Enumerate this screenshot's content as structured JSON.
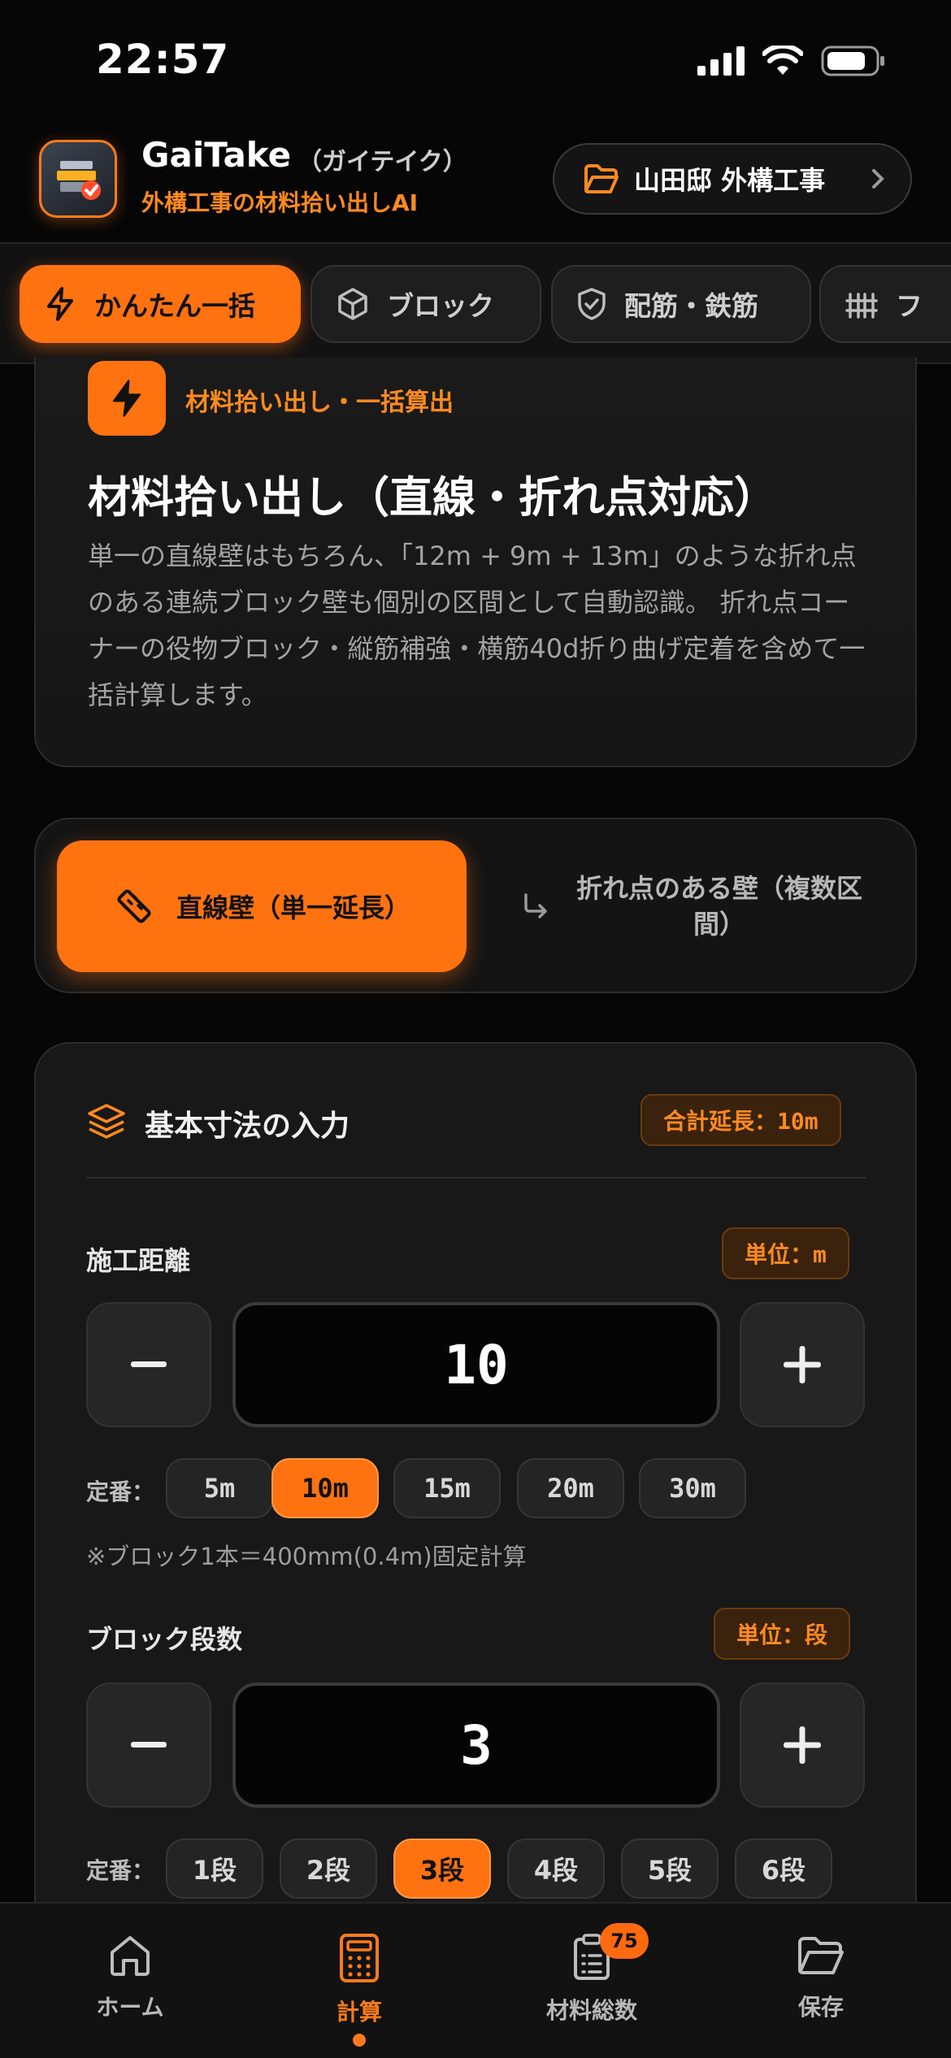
{
  "status_bar": {
    "time": "22:57"
  },
  "app": {
    "name": "GaiTake",
    "name_kana": "（ガイテイク）",
    "subtitle": "外構工事の材料拾い出しAI",
    "project": "山田邸 外構工事"
  },
  "tabs": [
    {
      "label": "かんたん一括",
      "icon": "bolt-icon",
      "active": true
    },
    {
      "label": "ブロック",
      "icon": "cube-icon",
      "active": false
    },
    {
      "label": "配筋・鉄筋",
      "icon": "shield-icon",
      "active": false
    },
    {
      "label": "フ",
      "icon": "fence-icon",
      "active": false
    }
  ],
  "intro": {
    "tag": "材料拾い出し・一括算出",
    "title": "材料拾い出し（直線・折れ点対応）",
    "description": "単一の直線壁はもちろん、「12m + 9m + 13m」のような折れ点のある連続ブロック壁も個別の区間として自動認識。 折れ点コーナーの役物ブロック・縦筋補強・横筋40d折り曲げ定着を含めて一括計算します。"
  },
  "mode": {
    "straight": "直線壁（単一延長）",
    "bent": "折れ点のある壁（複数区間）",
    "selected": "straight"
  },
  "dimensions": {
    "title": "基本寸法の入力",
    "total_badge": "合計延長：10m",
    "distance": {
      "label": "施工距離",
      "unit_badge": "単位：m",
      "value": "10",
      "preset_label": "定番：",
      "presets": [
        "5m",
        "10m",
        "15m",
        "20m",
        "30m"
      ],
      "selected_preset": 1,
      "note": "※ブロック1本＝400mm(0.4m)固定計算"
    },
    "rows": {
      "label": "ブロック段数",
      "unit_badge": "単位：段",
      "value": "3",
      "preset_label": "定番：",
      "presets": [
        "1段",
        "2段",
        "3段",
        "4段",
        "5段",
        "6段"
      ],
      "selected_preset": 2
    }
  },
  "bottom_nav": [
    {
      "label": "ホーム",
      "icon": "home-icon",
      "active": false
    },
    {
      "label": "計算",
      "icon": "calculator-icon",
      "active": true
    },
    {
      "label": "材料総数",
      "icon": "clipboard-list-icon",
      "active": false,
      "badge": "75"
    },
    {
      "label": "保存",
      "icon": "folder-open-icon",
      "active": false
    }
  ],
  "colors": {
    "accent": "#ff7210",
    "background": "#060606",
    "card": "#181818"
  }
}
